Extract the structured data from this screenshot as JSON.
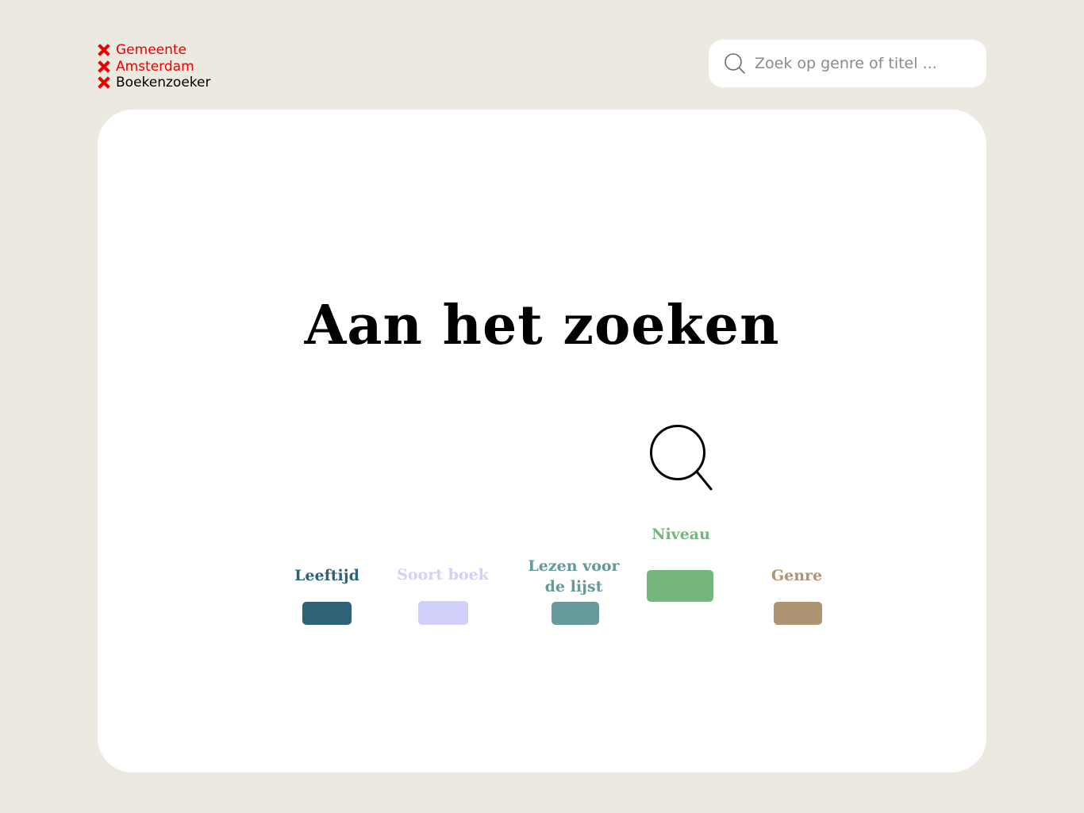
{
  "brand": {
    "line1": "Gemeente",
    "line2": "Amsterdam",
    "line3": "Boekenzoeker",
    "red_color": "#EC0000"
  },
  "search": {
    "placeholder": "Zoek op genre of titel ...",
    "icon": "search-icon"
  },
  "main": {
    "title": "Aan het zoeken",
    "status_icon": "search-icon"
  },
  "filters": [
    {
      "label": "Leeftijd",
      "color": "#2E6377"
    },
    {
      "label": "Soort boek",
      "color": "#D1D1FB"
    },
    {
      "label": "Lezen voor\nde lijst",
      "color": "#669999"
    },
    {
      "label": "Niveau",
      "color": "#75B67D"
    },
    {
      "label": "Genre",
      "color": "#AD9472"
    }
  ],
  "colors": {
    "background": "#ECE9E1",
    "card": "#FFFFFF"
  }
}
